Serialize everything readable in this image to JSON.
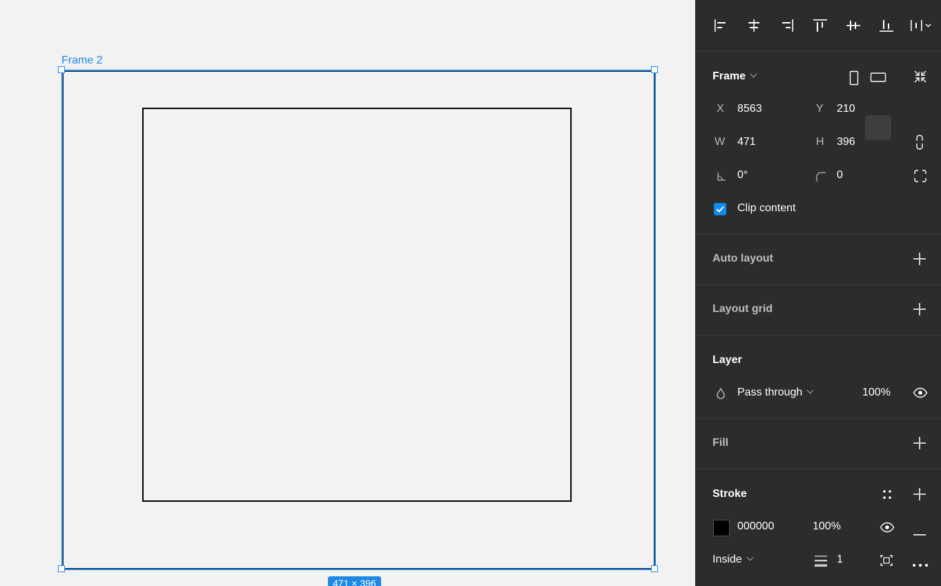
{
  "canvas": {
    "frame_label": "Frame 2",
    "size_badge": "471 × 396"
  },
  "toolbar": {
    "align_icons": [
      "align-left-icon",
      "align-horizontal-center-icon",
      "align-right-icon",
      "align-top-icon",
      "align-vertical-center-icon",
      "align-bottom-icon",
      "distribute-icon"
    ]
  },
  "frame_section": {
    "title": "Frame",
    "x_label": "X",
    "x_value": "8563",
    "y_label": "Y",
    "y_value": "210",
    "w_label": "W",
    "w_value": "471",
    "h_label": "H",
    "h_value": "396",
    "rotation_value": "0°",
    "radius_value": "0",
    "clip_label": "Clip content",
    "clip_checked": true
  },
  "auto_layout": {
    "title": "Auto layout"
  },
  "layout_grid": {
    "title": "Layout grid"
  },
  "layer": {
    "title": "Layer",
    "blend_mode": "Pass through",
    "opacity": "100%"
  },
  "fill": {
    "title": "Fill"
  },
  "stroke": {
    "title": "Stroke",
    "color_hex": "000000",
    "opacity": "100%",
    "position": "Inside",
    "weight": "1",
    "swatch_color": "#000000"
  },
  "colors": {
    "accent": "#1e88e5",
    "panel_bg": "#2c2c2c",
    "canvas_bg": "#f2f2f2"
  }
}
